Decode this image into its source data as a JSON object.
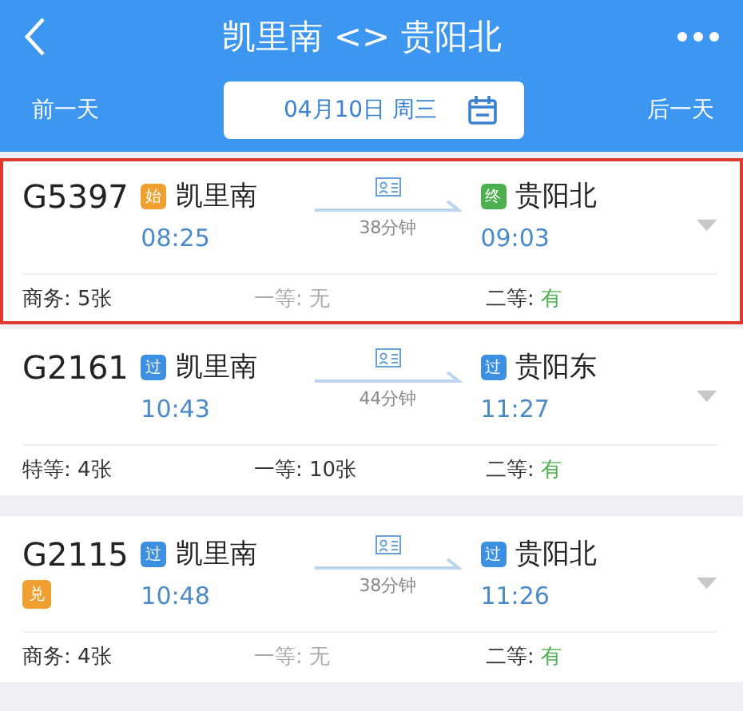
{
  "header": {
    "title": "凯里南 <> 贵阳北",
    "prev_day": "前一天",
    "date": "04月10日 周三",
    "next_day": "后一天"
  },
  "trains": [
    {
      "number": "G5397",
      "selected": true,
      "from": {
        "badge": "始",
        "color": "#f0a030",
        "station": "凯里南",
        "time": "08:25"
      },
      "duration": "38分钟",
      "to": {
        "badge": "终",
        "color": "#4caf50",
        "station": "贵阳北",
        "time": "09:03"
      },
      "seats": [
        {
          "label": "商务:",
          "value": "5张",
          "kind": "count"
        },
        {
          "label": "一等:",
          "value": "无",
          "kind": "none"
        },
        {
          "label": "二等:",
          "value": "有",
          "kind": "plenty"
        }
      ]
    },
    {
      "number": "G2161",
      "selected": false,
      "from": {
        "badge": "过",
        "color": "#3d8fe0",
        "station": "凯里南",
        "time": "10:43"
      },
      "duration": "44分钟",
      "to": {
        "badge": "过",
        "color": "#3d8fe0",
        "station": "贵阳东",
        "time": "11:27"
      },
      "seats": [
        {
          "label": "特等:",
          "value": "4张",
          "kind": "count"
        },
        {
          "label": "一等:",
          "value": "10张",
          "kind": "count"
        },
        {
          "label": "二等:",
          "value": "有",
          "kind": "plenty"
        }
      ]
    },
    {
      "number": "G2115",
      "selected": false,
      "tag": {
        "text": "兑",
        "color": "#f0a030"
      },
      "from": {
        "badge": "过",
        "color": "#3d8fe0",
        "station": "凯里南",
        "time": "10:48"
      },
      "duration": "38分钟",
      "to": {
        "badge": "过",
        "color": "#3d8fe0",
        "station": "贵阳北",
        "time": "11:26"
      },
      "seats": [
        {
          "label": "商务:",
          "value": "4张",
          "kind": "count"
        },
        {
          "label": "一等:",
          "value": "无",
          "kind": "none"
        },
        {
          "label": "二等:",
          "value": "有",
          "kind": "plenty"
        }
      ]
    }
  ]
}
